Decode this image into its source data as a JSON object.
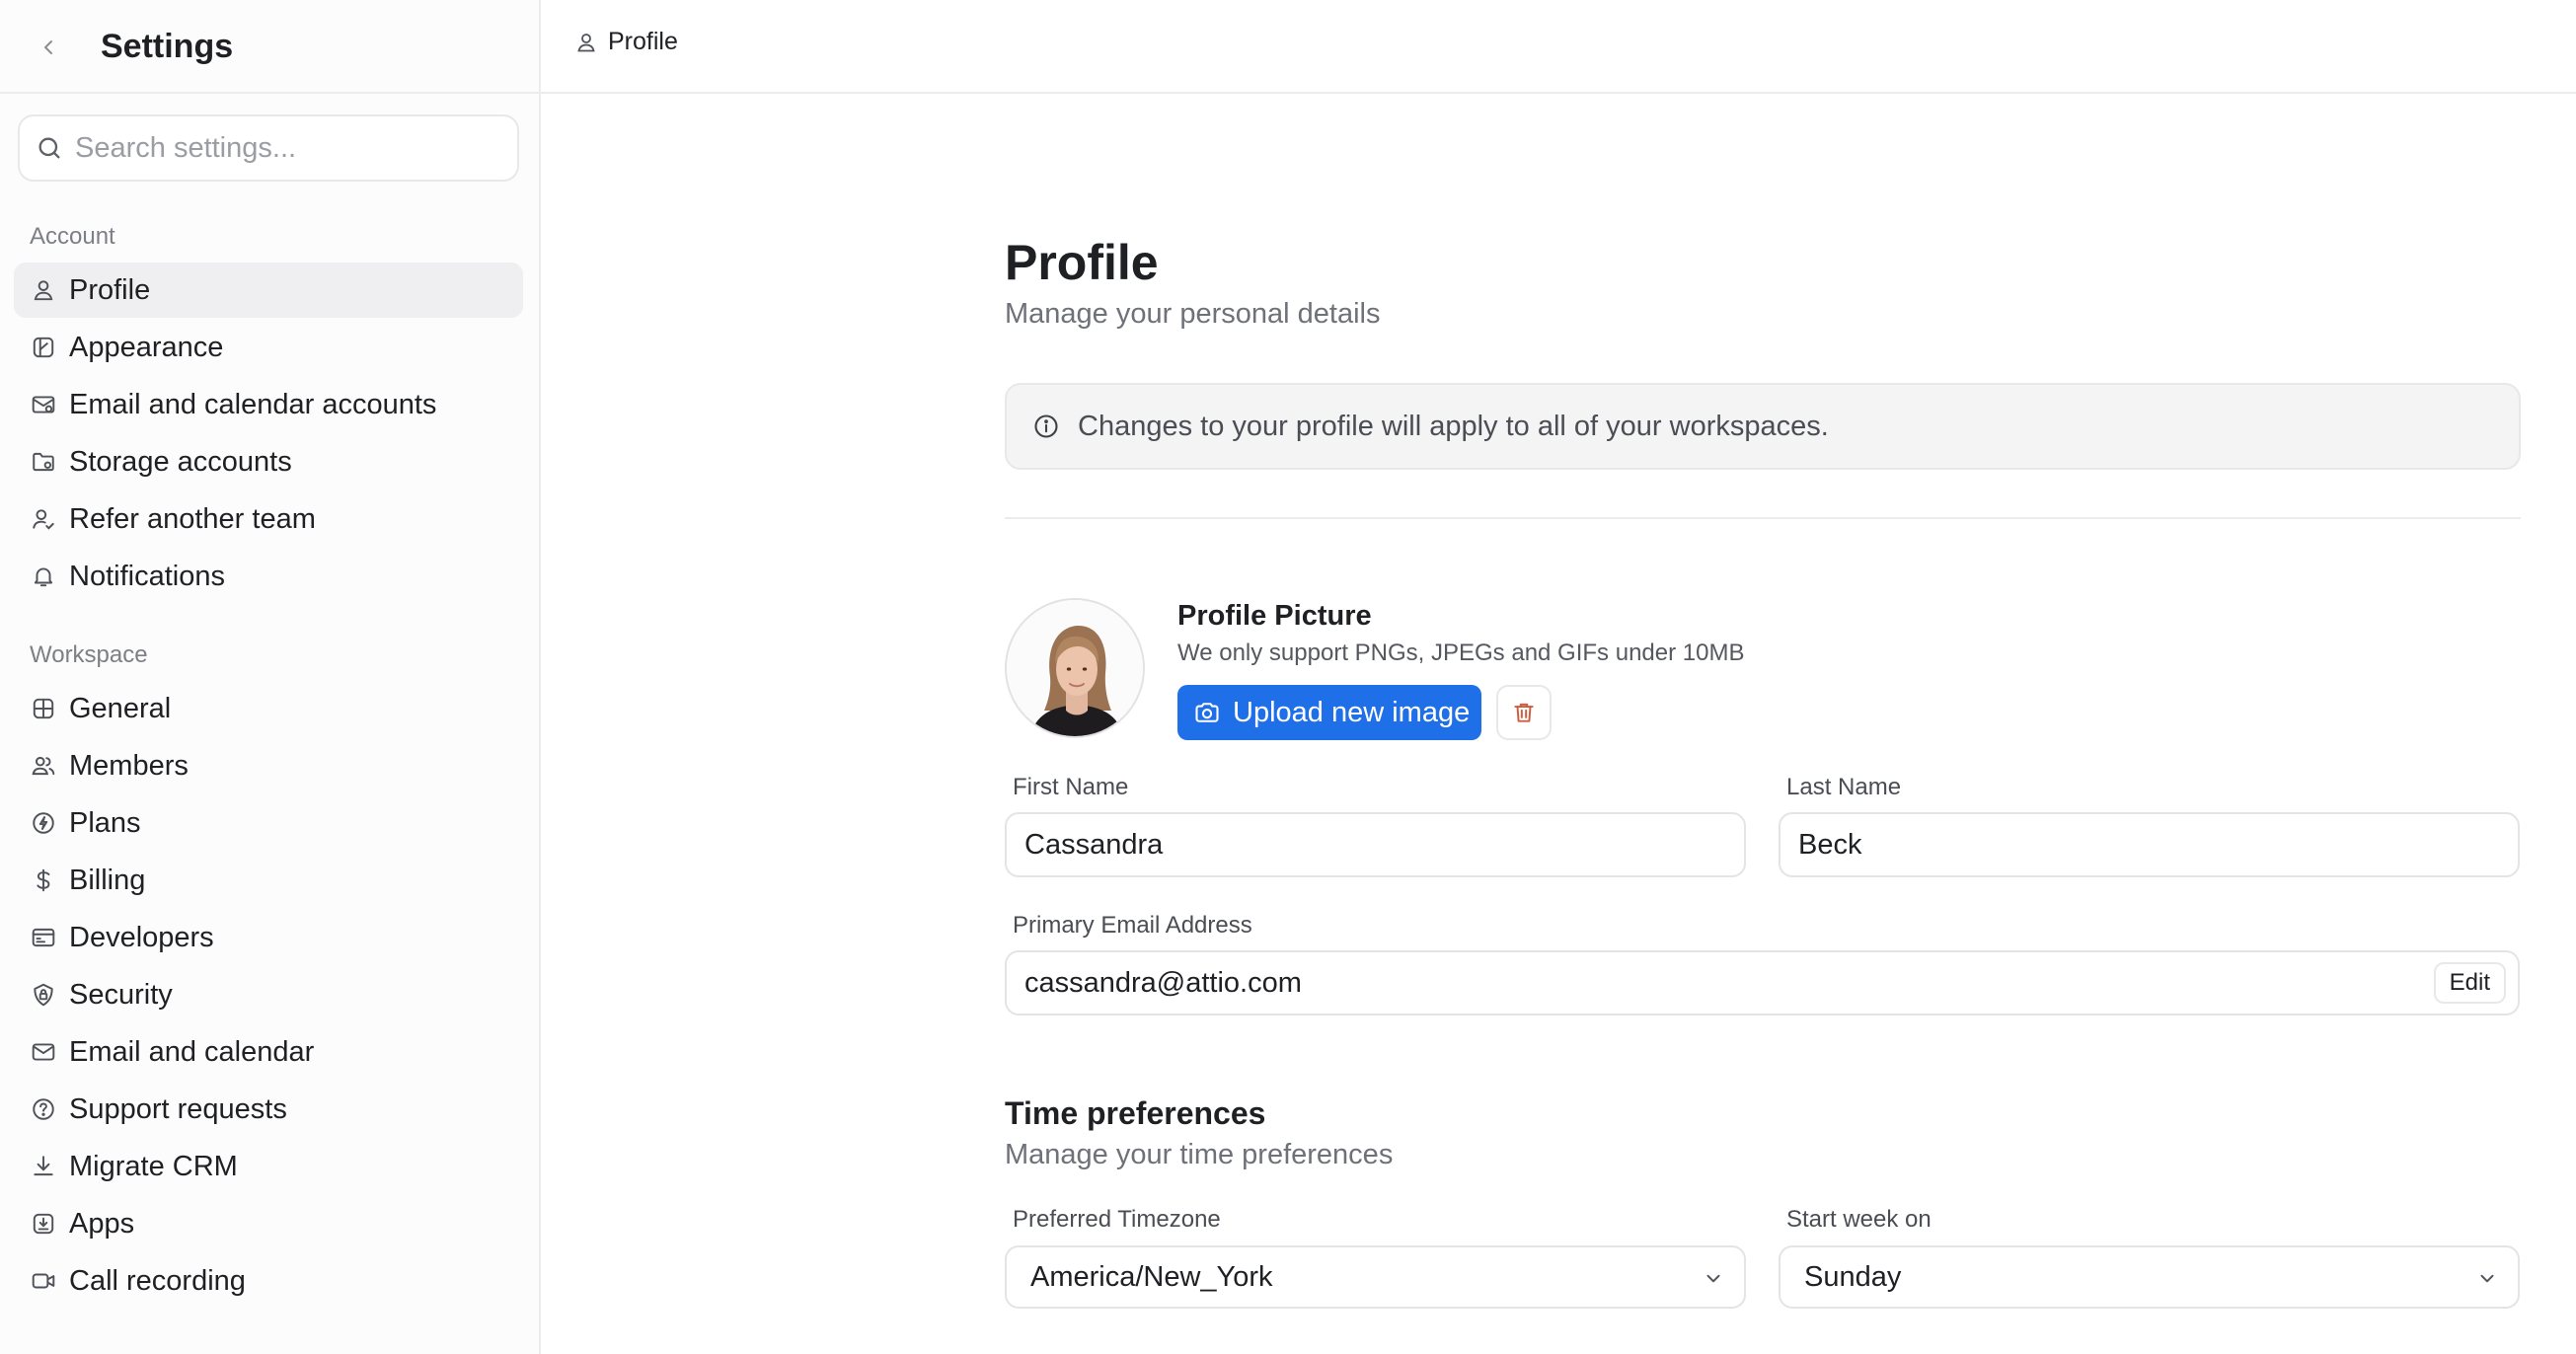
{
  "sidebar": {
    "title": "Settings",
    "search_placeholder": "Search settings...",
    "account_label": "Account",
    "account_items": [
      {
        "label": "Profile",
        "icon": "user-icon"
      },
      {
        "label": "Appearance",
        "icon": "palette-icon"
      },
      {
        "label": "Email and calendar accounts",
        "icon": "mail-accounts-icon"
      },
      {
        "label": "Storage accounts",
        "icon": "folder-icon"
      },
      {
        "label": "Refer another team",
        "icon": "user-plus-icon"
      },
      {
        "label": "Notifications",
        "icon": "bell-icon"
      }
    ],
    "workspace_label": "Workspace",
    "workspace_items": [
      {
        "label": "General",
        "icon": "grid-icon"
      },
      {
        "label": "Members",
        "icon": "users-icon"
      },
      {
        "label": "Plans",
        "icon": "plans-icon"
      },
      {
        "label": "Billing",
        "icon": "dollar-icon"
      },
      {
        "label": "Developers",
        "icon": "terminal-icon"
      },
      {
        "label": "Security",
        "icon": "shield-icon"
      },
      {
        "label": "Email and calendar",
        "icon": "envelope-icon"
      },
      {
        "label": "Support requests",
        "icon": "help-circle-icon"
      },
      {
        "label": "Migrate CRM",
        "icon": "download-icon"
      },
      {
        "label": "Apps",
        "icon": "apps-icon"
      },
      {
        "label": "Call recording",
        "icon": "video-icon"
      }
    ]
  },
  "topbar": {
    "breadcrumb": "Profile"
  },
  "main": {
    "title": "Profile",
    "subtitle": "Manage your personal details",
    "notice": "Changes to your profile will apply to all of your workspaces.",
    "picture": {
      "title": "Profile Picture",
      "hint": "We only support PNGs, JPEGs and GIFs under 10MB",
      "upload_label": "Upload new image"
    },
    "first_name": {
      "label": "First Name",
      "value": "Cassandra"
    },
    "last_name": {
      "label": "Last Name",
      "value": "Beck"
    },
    "email": {
      "label": "Primary Email Address",
      "value": "cassandra@attio.com",
      "edit_label": "Edit"
    },
    "time": {
      "title": "Time preferences",
      "subtitle": "Manage your time preferences",
      "timezone": {
        "label": "Preferred Timezone",
        "value": "America/New_York"
      },
      "week_start": {
        "label": "Start week on",
        "value": "Sunday"
      }
    }
  },
  "colors": {
    "accent": "#1f6fe8",
    "danger": "#d25b3d",
    "active_bg": "#efeff1"
  }
}
